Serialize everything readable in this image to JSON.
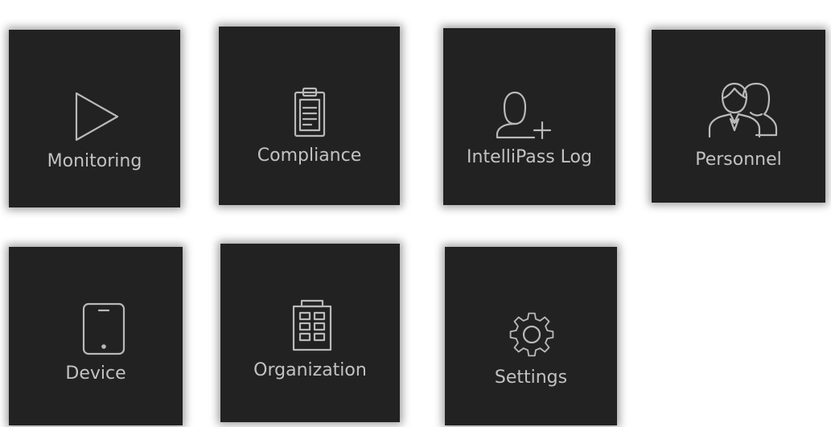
{
  "colors": {
    "tile_background": "#222222",
    "icon_stroke": "#b9b9b9",
    "label_text": "#c2c2c2",
    "page_background": "#ffffff"
  },
  "tiles": [
    {
      "id": "monitoring",
      "label": "Monitoring",
      "icon": "play-icon"
    },
    {
      "id": "compliance",
      "label": "Compliance",
      "icon": "clipboard-icon"
    },
    {
      "id": "intellipass",
      "label": "IntelliPass Log",
      "icon": "add-user-icon"
    },
    {
      "id": "personnel",
      "label": "Personnel",
      "icon": "people-icon"
    },
    {
      "id": "device",
      "label": "Device",
      "icon": "tablet-icon"
    },
    {
      "id": "organization",
      "label": "Organization",
      "icon": "building-icon"
    },
    {
      "id": "settings",
      "label": "Settings",
      "icon": "gear-icon"
    }
  ]
}
